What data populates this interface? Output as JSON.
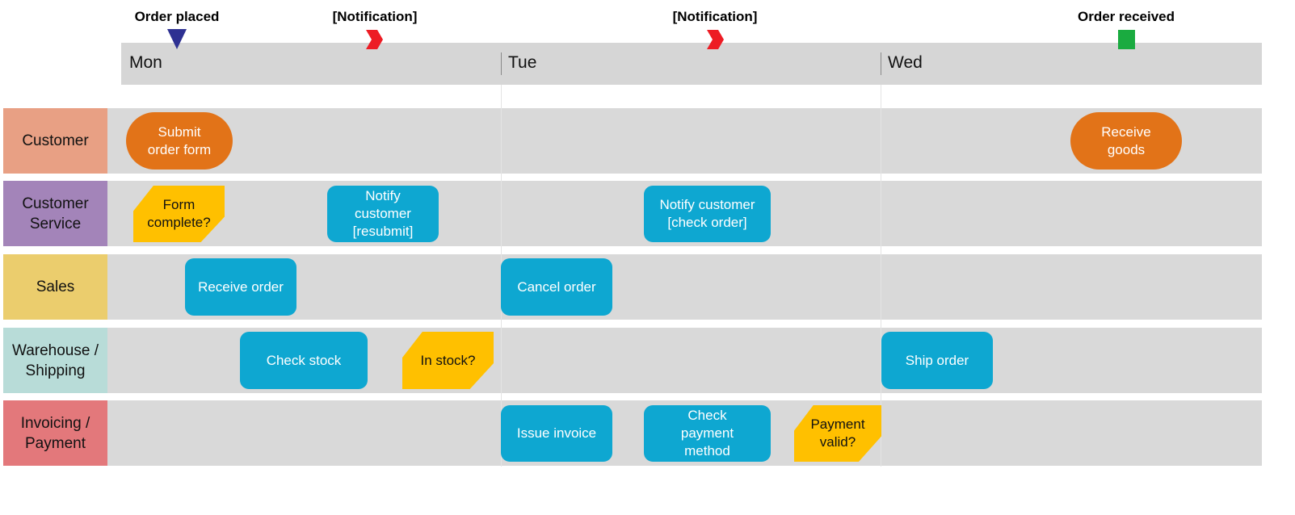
{
  "milestones": [
    {
      "label": "Order placed",
      "icon": "triangle-down-icon",
      "color": "#2e3192"
    },
    {
      "label": "[Notification]",
      "icon": "chevron-right-icon",
      "color": "#ed1c24"
    },
    {
      "label": "[Notification]",
      "icon": "chevron-right-icon",
      "color": "#ed1c24"
    },
    {
      "label": "Order received",
      "icon": "square-icon",
      "color": "#1aab40"
    }
  ],
  "days": [
    "Mon",
    "Tue",
    "Wed"
  ],
  "lanes": [
    {
      "label": "Customer",
      "color": "#e8a084"
    },
    {
      "label": "Customer Service",
      "color": "#a384b9"
    },
    {
      "label": "Sales",
      "color": "#ebcd6d"
    },
    {
      "label": "Warehouse / Shipping",
      "color": "#b8dcd8"
    },
    {
      "label": "Invoicing / Payment",
      "color": "#e3787b"
    }
  ],
  "nodes": {
    "submit_order_form": {
      "label": "Submit order form",
      "type": "terminal",
      "lane": "Customer"
    },
    "receive_goods": {
      "label": "Receive goods",
      "type": "terminal",
      "lane": "Customer"
    },
    "form_complete": {
      "label": "Form complete?",
      "type": "decision",
      "lane": "Customer Service"
    },
    "notify_resubmit": {
      "label": "Notify customer [resubmit]",
      "type": "task",
      "lane": "Customer Service"
    },
    "notify_check_order": {
      "label": "Notify customer [check order]",
      "type": "task",
      "lane": "Customer Service"
    },
    "receive_order": {
      "label": "Receive order",
      "type": "task",
      "lane": "Sales"
    },
    "cancel_order": {
      "label": "Cancel order",
      "type": "task",
      "lane": "Sales"
    },
    "check_stock": {
      "label": "Check stock",
      "type": "task",
      "lane": "Warehouse / Shipping"
    },
    "in_stock": {
      "label": "In stock?",
      "type": "decision",
      "lane": "Warehouse / Shipping"
    },
    "ship_order": {
      "label": "Ship order",
      "type": "task",
      "lane": "Warehouse / Shipping"
    },
    "issue_invoice": {
      "label": "Issue invoice",
      "type": "task",
      "lane": "Invoicing / Payment"
    },
    "check_payment_method": {
      "label": "Check payment method",
      "type": "task",
      "lane": "Invoicing / Payment"
    },
    "payment_valid": {
      "label": "Payment valid?",
      "type": "decision",
      "lane": "Invoicing / Payment"
    }
  },
  "colors": {
    "task": "#0ea7d1",
    "terminal": "#e27318",
    "decision": "#ffc000",
    "lane_background": "#d9d9d9",
    "timeline_background": "#d6d6d6"
  }
}
